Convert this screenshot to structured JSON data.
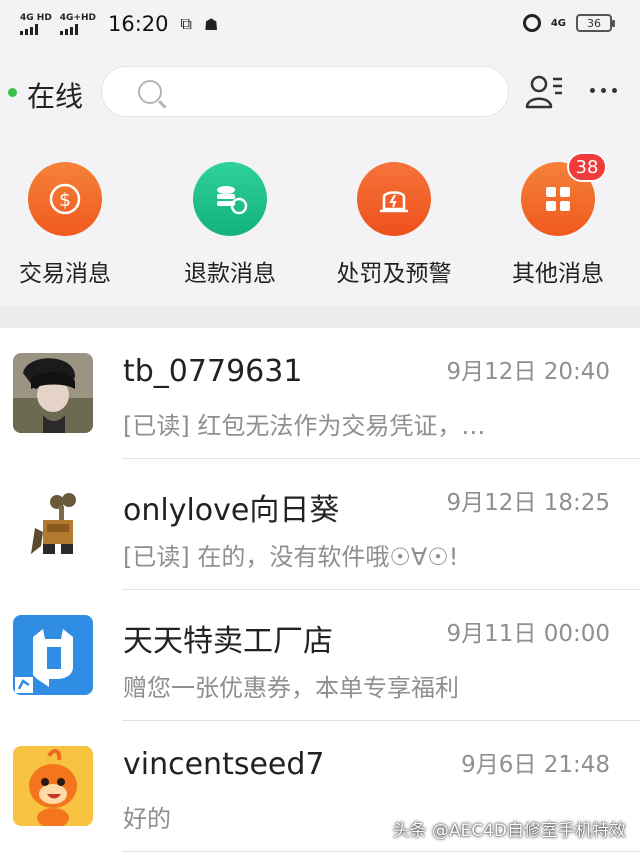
{
  "status_bar": {
    "signal_1_label": "4G HD",
    "signal_2_label": "4G+HD",
    "time": "16:20",
    "network_label": "4G",
    "battery_level": "36"
  },
  "header": {
    "status_label": "在线",
    "status_color": "#38c24a",
    "search_placeholder": "",
    "contacts_icon": "contacts-icon",
    "more_icon": "more-icon"
  },
  "categories": [
    {
      "label": "交易消息",
      "icon": "dollar-icon",
      "color": "#f26b21"
    },
    {
      "label": "退款消息",
      "icon": "refund-icon",
      "color": "#1bbf8a"
    },
    {
      "label": "处罚及预警",
      "icon": "alarm-light-icon",
      "color": "#f25b1f"
    },
    {
      "label": "其他消息",
      "icon": "apps-icon",
      "color": "#f26b21",
      "badge": "38"
    }
  ],
  "conversations": [
    {
      "name": "tb_0779631",
      "time": "9月12日 20:40",
      "message": "[已读] 红包无法作为交易凭证，…"
    },
    {
      "name": "onlylove向日葵",
      "time": "9月12日 18:25",
      "message": "[已读] 在的，没有软件哦☉∀☉!"
    },
    {
      "name": "天天特卖工厂店",
      "time": "9月11日 00:00",
      "message": "赠您一张优惠券，本单专享福利"
    },
    {
      "name": "vincentseed7",
      "time": "9月6日 21:48",
      "message": "好的"
    }
  ],
  "watermark": "头条 @AEC4D自修室手机特效"
}
